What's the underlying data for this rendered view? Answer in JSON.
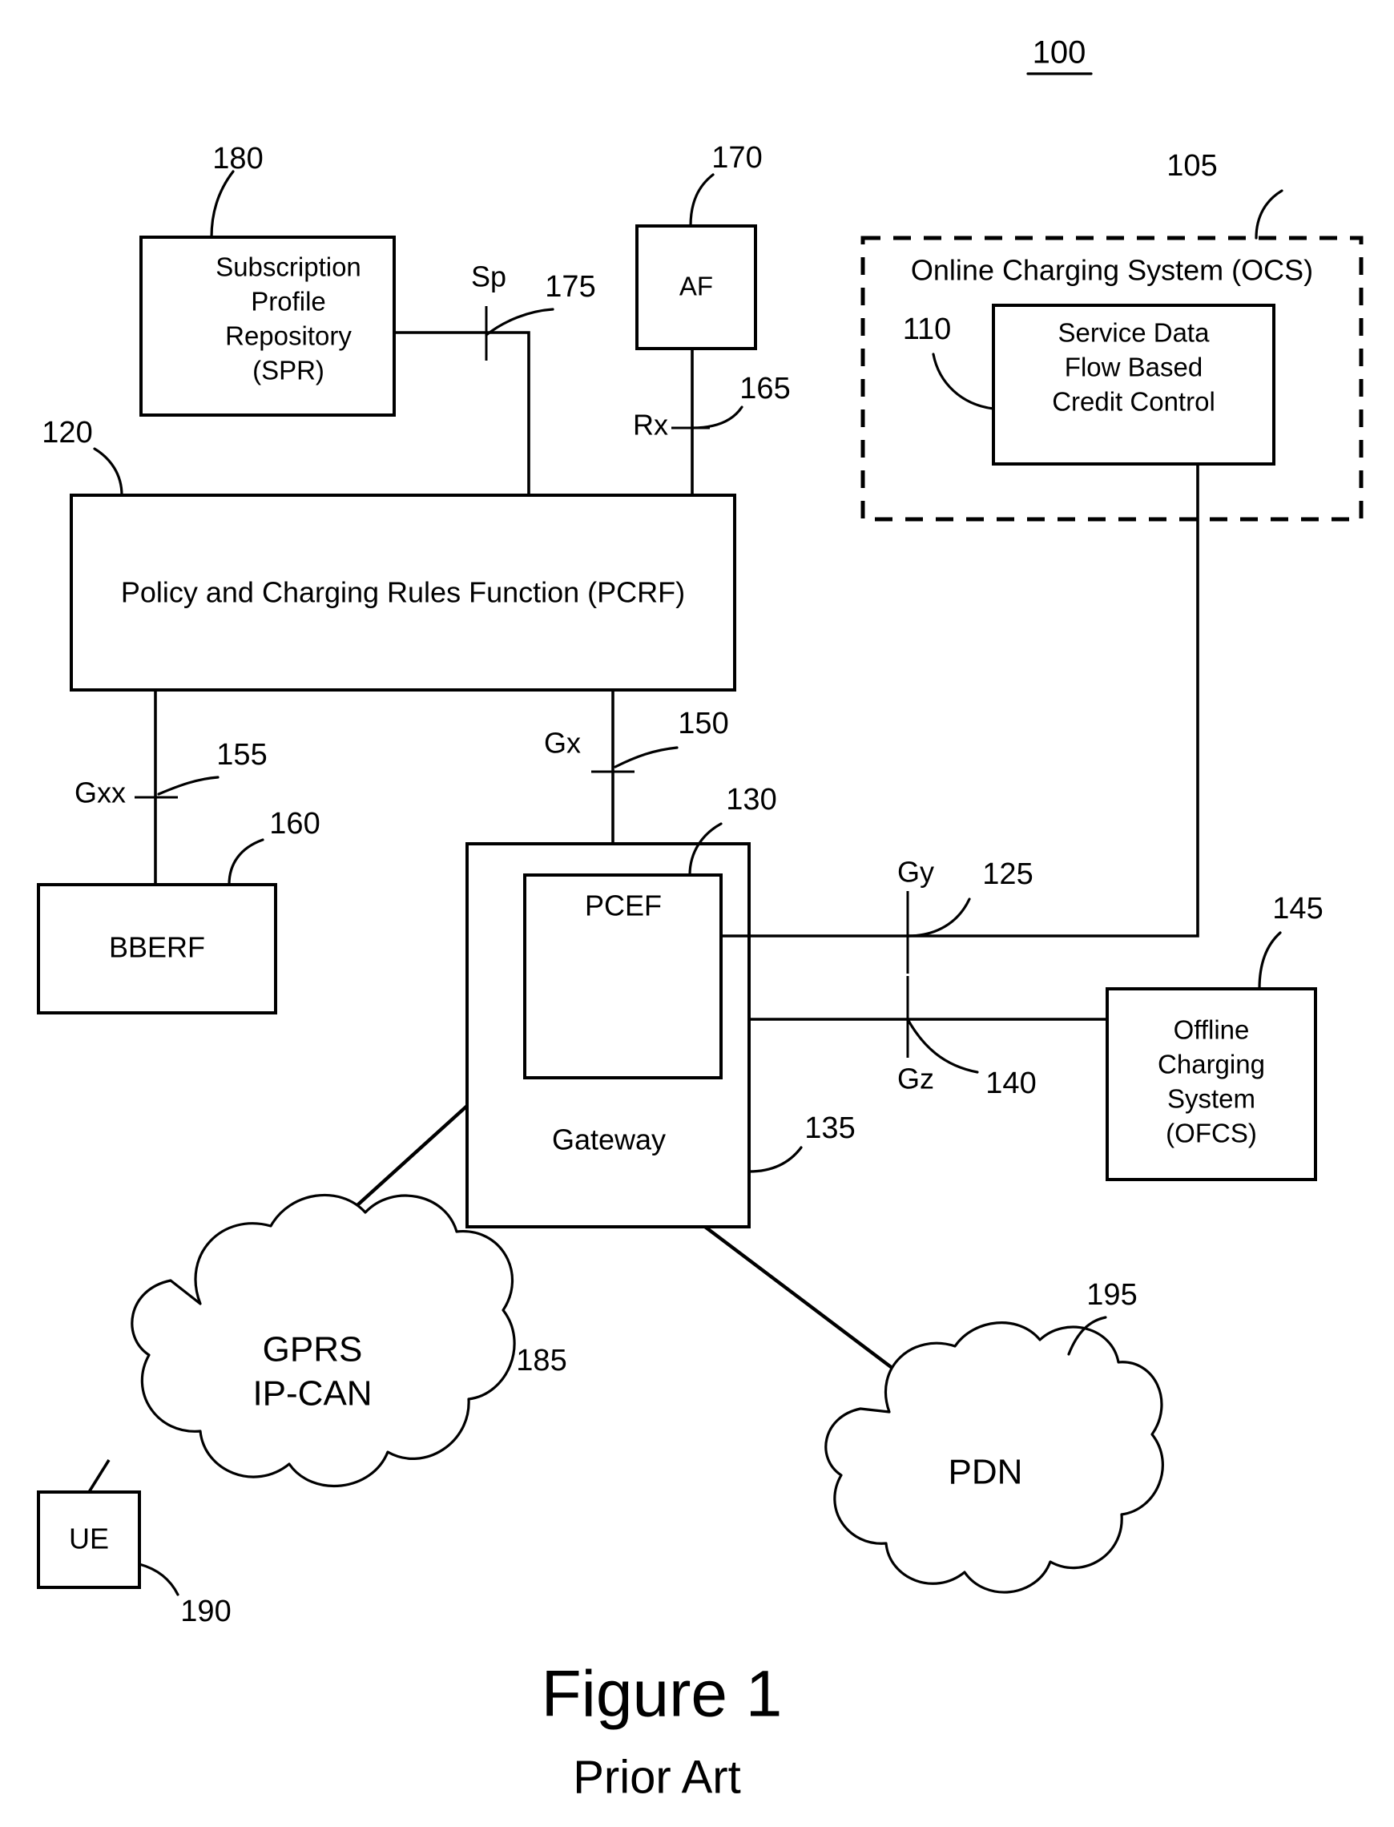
{
  "figure": {
    "number_label": "100",
    "title": "Figure 1",
    "subtitle": "Prior Art"
  },
  "nodes": {
    "spr": {
      "ref": "180",
      "lines": [
        "Subscription",
        "Profile",
        "Repository",
        "(SPR)"
      ]
    },
    "af": {
      "ref": "170",
      "label": "AF"
    },
    "ocs": {
      "ref": "105",
      "label": "Online Charging System (OCS)"
    },
    "sdf_credit_control": {
      "ref": "110",
      "lines": [
        "Service Data",
        "Flow Based",
        "Credit Control"
      ]
    },
    "pcrf": {
      "ref": "120",
      "label": "Policy and Charging Rules Function (PCRF)"
    },
    "bberf": {
      "ref": "160",
      "label": "BBERF"
    },
    "gateway": {
      "ref": "135",
      "label": "Gateway"
    },
    "pcef": {
      "ref": "130",
      "label": "PCEF"
    },
    "ofcs": {
      "ref": "145",
      "lines": [
        "Offline",
        "Charging",
        "System",
        "(OFCS)"
      ]
    },
    "gprs_ipcan": {
      "ref": "185",
      "lines": [
        "GPRS",
        "IP-CAN"
      ]
    },
    "pdn": {
      "ref": "195",
      "label": "PDN"
    },
    "ue": {
      "ref": "190",
      "label": "UE"
    }
  },
  "interfaces": [
    {
      "name": "Sp",
      "ref": "175"
    },
    {
      "name": "Rx",
      "ref": "165"
    },
    {
      "name": "Gxx",
      "ref": "155"
    },
    {
      "name": "Gx",
      "ref": "150"
    },
    {
      "name": "Gy",
      "ref": "125"
    },
    {
      "name": "Gz",
      "ref": "140"
    }
  ],
  "colors": {
    "ink": "#000000",
    "paper": "#ffffff"
  }
}
